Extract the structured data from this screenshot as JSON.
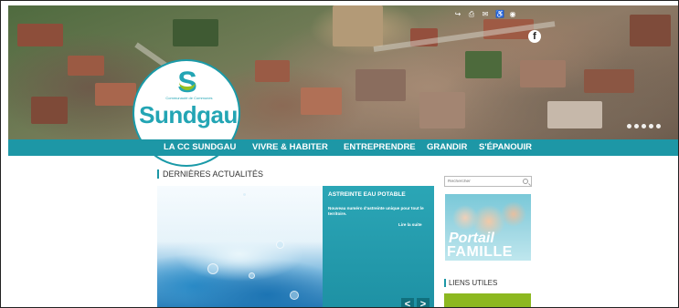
{
  "social": [
    "share-icon",
    "print-icon",
    "mail-icon",
    "accessibility-icon",
    "eye-icon"
  ],
  "social_glyphs": [
    "↪",
    "⎙",
    "✉",
    "♿",
    "◉"
  ],
  "facebook": "f",
  "logo": {
    "letter": "S",
    "tagline": "Communauté de Communes",
    "name": "Sundgau"
  },
  "slider_dots": 5,
  "nav": [
    "LA CC SUNDGAU",
    "VIVRE & HABITER",
    "ENTREPRENDRE",
    "GRANDIR",
    "S'ÉPANOUIR"
  ],
  "news_section": {
    "title": "DERNIÈRES ACTUALITÉS",
    "item": {
      "title": "ASTREINTE EAU POTABLE",
      "text": "Nouveau numéro d'astreinte unique pour tout le territoire.",
      "more": "Lire la suite"
    },
    "prev": "<",
    "next": ">"
  },
  "search": {
    "placeholder": "Rechercher"
  },
  "portail": {
    "line1": "Portail",
    "line2": "FAMILLE"
  },
  "liens": {
    "title": "LIENS UTILES"
  },
  "colors": {
    "brand": "#1d97a6",
    "green": "#8cb820"
  }
}
